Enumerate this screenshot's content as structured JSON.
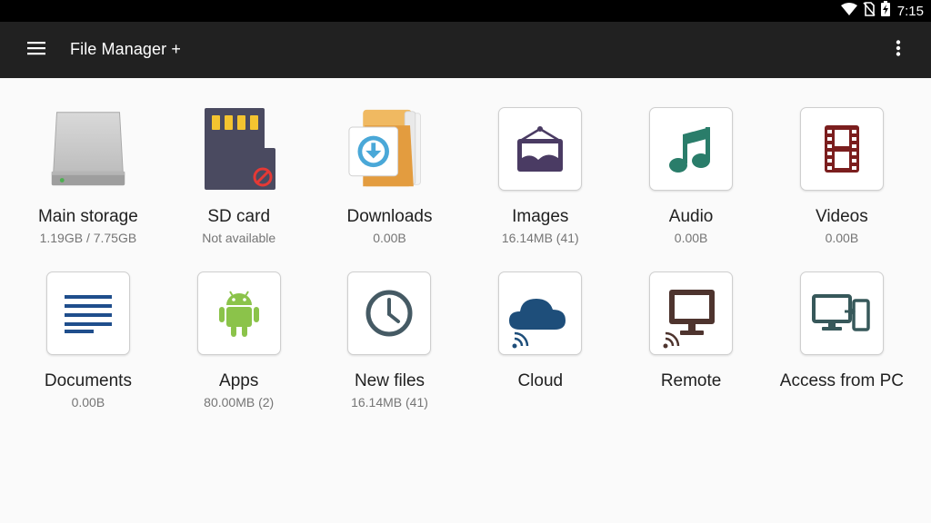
{
  "status_bar": {
    "time": "7:15",
    "icons": [
      "wifi-icon",
      "no-sim-icon",
      "battery-charging-icon"
    ]
  },
  "app_bar": {
    "title": "File Manager +",
    "menu_icon": "hamburger-menu-icon",
    "overflow_icon": "more-vert-icon"
  },
  "tiles": [
    {
      "label": "Main storage",
      "sub": "1.19GB / 7.75GB",
      "icon": "hard-drive-icon"
    },
    {
      "label": "SD card",
      "sub": "Not available",
      "icon": "sd-card-icon"
    },
    {
      "label": "Downloads",
      "sub": "0.00B",
      "icon": "downloads-folder-icon"
    },
    {
      "label": "Images",
      "sub": "16.14MB (41)",
      "icon": "image-frame-icon"
    },
    {
      "label": "Audio",
      "sub": "0.00B",
      "icon": "music-note-icon"
    },
    {
      "label": "Videos",
      "sub": "0.00B",
      "icon": "film-strip-icon"
    },
    {
      "label": "Documents",
      "sub": "0.00B",
      "icon": "document-lines-icon"
    },
    {
      "label": "Apps",
      "sub": "80.00MB (2)",
      "icon": "android-icon"
    },
    {
      "label": "New files",
      "sub": "16.14MB (41)",
      "icon": "clock-icon"
    },
    {
      "label": "Cloud",
      "sub": "",
      "icon": "cloud-icon"
    },
    {
      "label": "Remote",
      "sub": "",
      "icon": "monitor-icon"
    },
    {
      "label": "Access from PC",
      "sub": "",
      "icon": "pc-to-phone-icon"
    }
  ],
  "colors": {
    "app_bar": "#212121",
    "status_bar": "#000000",
    "background": "#fafafa",
    "image_purple": "#4a3b63",
    "audio_teal": "#2a7d6a",
    "video_red": "#7b1e1e",
    "doc_blue": "#1f4e8c",
    "android_green": "#8bc34a",
    "clock_slate": "#455a64",
    "cloud_blue": "#1e4e7a",
    "remote_brown": "#4e342e",
    "pc_teal": "#37585a"
  }
}
